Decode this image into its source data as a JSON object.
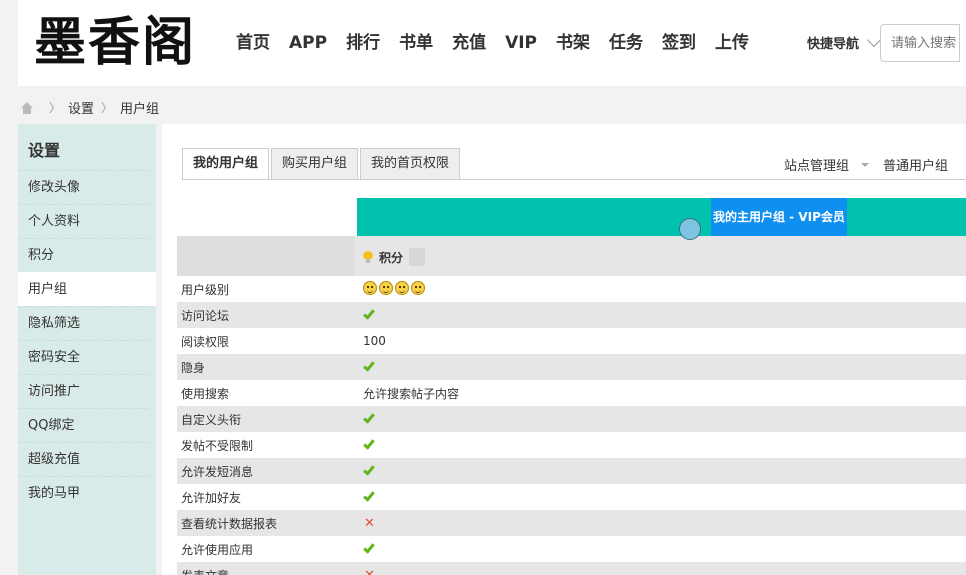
{
  "header": {
    "logo": "墨香阁",
    "nav": [
      "首页",
      "APP",
      "排行",
      "书单",
      "充值",
      "VIP",
      "书架",
      "任务",
      "签到",
      "上传"
    ],
    "quick_nav": "快捷导航",
    "search_placeholder": "请输入搜索"
  },
  "breadcrumb": [
    "设置",
    "用户组"
  ],
  "sidebar": {
    "title": "设置",
    "items": [
      "修改头像",
      "个人资料",
      "积分",
      "用户组",
      "隐私筛选",
      "密码安全",
      "访问推广",
      "QQ绑定",
      "超级充值",
      "我的马甲"
    ],
    "active": "用户组"
  },
  "tabs": [
    "我的用户组",
    "购买用户组",
    "我的首页权限"
  ],
  "right_links": [
    "站点管理组",
    "普通用户组"
  ],
  "group_label": "我的主用户组 - VIP会员",
  "credits_label": "积分",
  "permissions": [
    {
      "name": "用户级别",
      "type": "faces",
      "count": 4
    },
    {
      "name": "访问论坛",
      "type": "check"
    },
    {
      "name": "阅读权限",
      "type": "text",
      "value": "100"
    },
    {
      "name": "隐身",
      "type": "check"
    },
    {
      "name": "使用搜索",
      "type": "text",
      "value": "允许搜索帖子内容"
    },
    {
      "name": "自定义头衔",
      "type": "check"
    },
    {
      "name": "发帖不受限制",
      "type": "check"
    },
    {
      "name": "允许发短消息",
      "type": "check"
    },
    {
      "name": "允许加好友",
      "type": "check"
    },
    {
      "name": "查看统计数据报表",
      "type": "cross"
    },
    {
      "name": "允许使用应用",
      "type": "check"
    },
    {
      "name": "发表文章",
      "type": "cross"
    }
  ]
}
